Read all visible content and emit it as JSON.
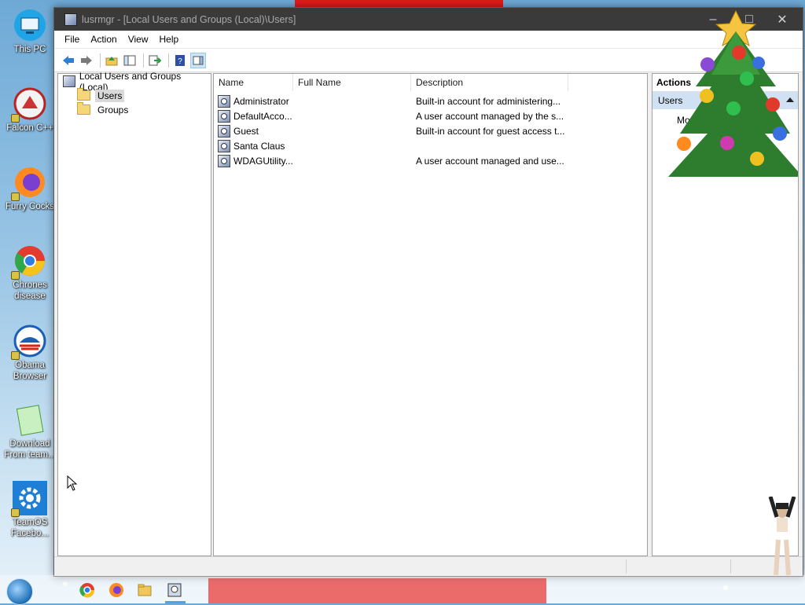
{
  "desktop": {
    "icons": [
      {
        "label": "This PC",
        "icon": "computer-icon"
      },
      {
        "label": "Falcon C++",
        "icon": "falcon-icon"
      },
      {
        "label": "Furry Cocks",
        "icon": "firefox-icon"
      },
      {
        "label": "Chrones disease",
        "icon": "chrome-icon"
      },
      {
        "label": "Obama Browser",
        "icon": "obama-icon"
      },
      {
        "label": "Download From team...",
        "icon": "notepad-icon"
      },
      {
        "label": "TeamOS Facebo...",
        "icon": "gear-icon"
      }
    ]
  },
  "window": {
    "title": "lusrmgr - [Local Users and Groups (Local)\\Users]",
    "controls": {
      "minimize": "–",
      "maximize": "□",
      "close": "✕"
    },
    "menu": [
      "File",
      "Action",
      "View",
      "Help"
    ],
    "toolbar": [
      "back-icon",
      "forward-icon",
      "up-folder-icon",
      "show-tree-icon",
      "export-icon",
      "help-icon",
      "view-icon"
    ],
    "tree": {
      "root": "Local Users and Groups (Local)",
      "children": [
        "Users",
        "Groups"
      ],
      "selected": "Users"
    },
    "list": {
      "columns": [
        "Name",
        "Full Name",
        "Description"
      ],
      "rows": [
        {
          "name": "Administrator",
          "full_name": "",
          "description": "Built-in account for administering..."
        },
        {
          "name": "DefaultAcco...",
          "full_name": "",
          "description": "A user account managed by the s..."
        },
        {
          "name": "Guest",
          "full_name": "",
          "description": "Built-in account for guest access t..."
        },
        {
          "name": "Santa Claus",
          "full_name": "",
          "description": ""
        },
        {
          "name": "WDAGUtility...",
          "full_name": "",
          "description": "A user account managed and use..."
        }
      ]
    },
    "actions": {
      "header": "Actions",
      "section": "Users",
      "item": "Mo"
    }
  },
  "colors": {
    "titlebar": "#3a3a3a",
    "selection": "#d9d9d9",
    "actions_section": "#cfe1f3",
    "santa_red": "#e11b1b"
  }
}
